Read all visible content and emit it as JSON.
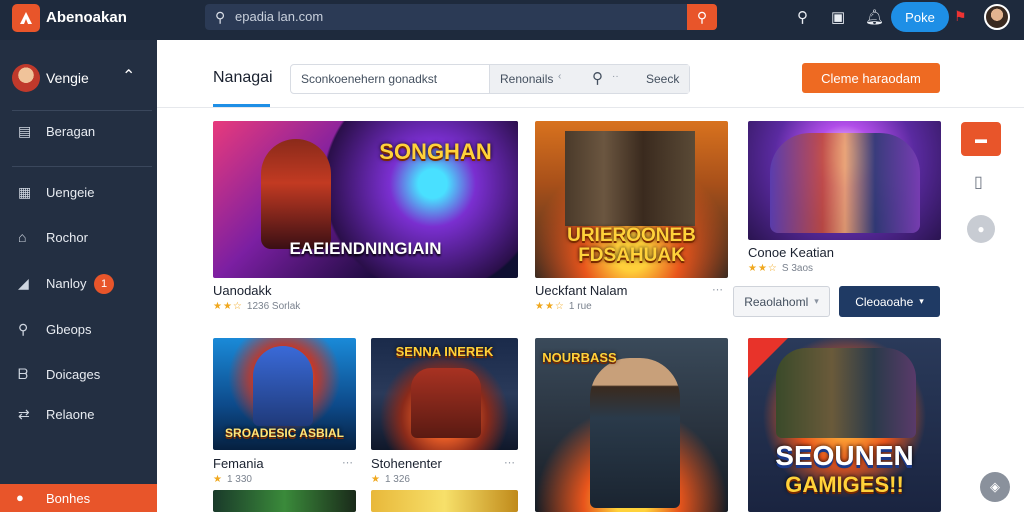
{
  "app": {
    "title": "Abenoakan"
  },
  "topbar": {
    "search_text": "epadia lan.com",
    "action_button": "Poke",
    "icons": [
      "search-icon",
      "tablet-icon",
      "bell-icon",
      "flag-icon",
      "avatar"
    ]
  },
  "sidebar": {
    "user_name": "Vengie",
    "items": [
      {
        "icon": "book-icon",
        "label": "Beragan"
      },
      {
        "icon": "gamepad-icon",
        "label": "Uengeie"
      },
      {
        "icon": "home-icon",
        "label": "Rochor"
      },
      {
        "icon": "trend-icon",
        "label": "Nanloy",
        "badge": "1"
      },
      {
        "icon": "search-icon",
        "label": "Gbeops"
      },
      {
        "icon": "bookmark-icon",
        "label": "Doicages"
      },
      {
        "icon": "shuffle-icon",
        "label": "Relaone"
      }
    ],
    "active_item": {
      "icon": "circle-icon",
      "label": "Bonhes"
    }
  },
  "header": {
    "tab": "Nanagai",
    "filter_placeholder": "Sconkoenehern gonadkst",
    "filter_select": "Renonails",
    "filter_search_label": "Seeck",
    "create_button": "Cleme haraodam"
  },
  "cards": [
    {
      "name": "Uanodakk",
      "meta": "1236 Sorlak",
      "stars": "★★☆",
      "art": "SONGHAN",
      "art2": "EAEIENDNINGIAIN"
    },
    {
      "name": "Ueckfant Nalam",
      "meta": "1 rue",
      "stars": "★★☆",
      "art": "URIEROONEB",
      "art2": "FDSAHUAK"
    },
    {
      "name": "Conoe Keatian",
      "meta": "S 3aos",
      "stars": "★★☆",
      "art": ""
    },
    {
      "name": "Femania",
      "meta": "1 330",
      "stars": "★",
      "art": "SROADESIC ASBIAL"
    },
    {
      "name": "Stohenenter",
      "meta": "1 326",
      "stars": "★",
      "art": "SENNA INEREK"
    },
    {
      "name": "",
      "meta": "",
      "stars": "",
      "art": "NOURBASS"
    },
    {
      "name": "",
      "meta": "",
      "stars": "",
      "art": "SEOUNEN",
      "art2": "GAMIGES!!"
    }
  ],
  "actions": {
    "select_button": "Reaolahoml",
    "download_button": "Cleoaoahe"
  },
  "rail": {
    "top_label": "▬"
  }
}
